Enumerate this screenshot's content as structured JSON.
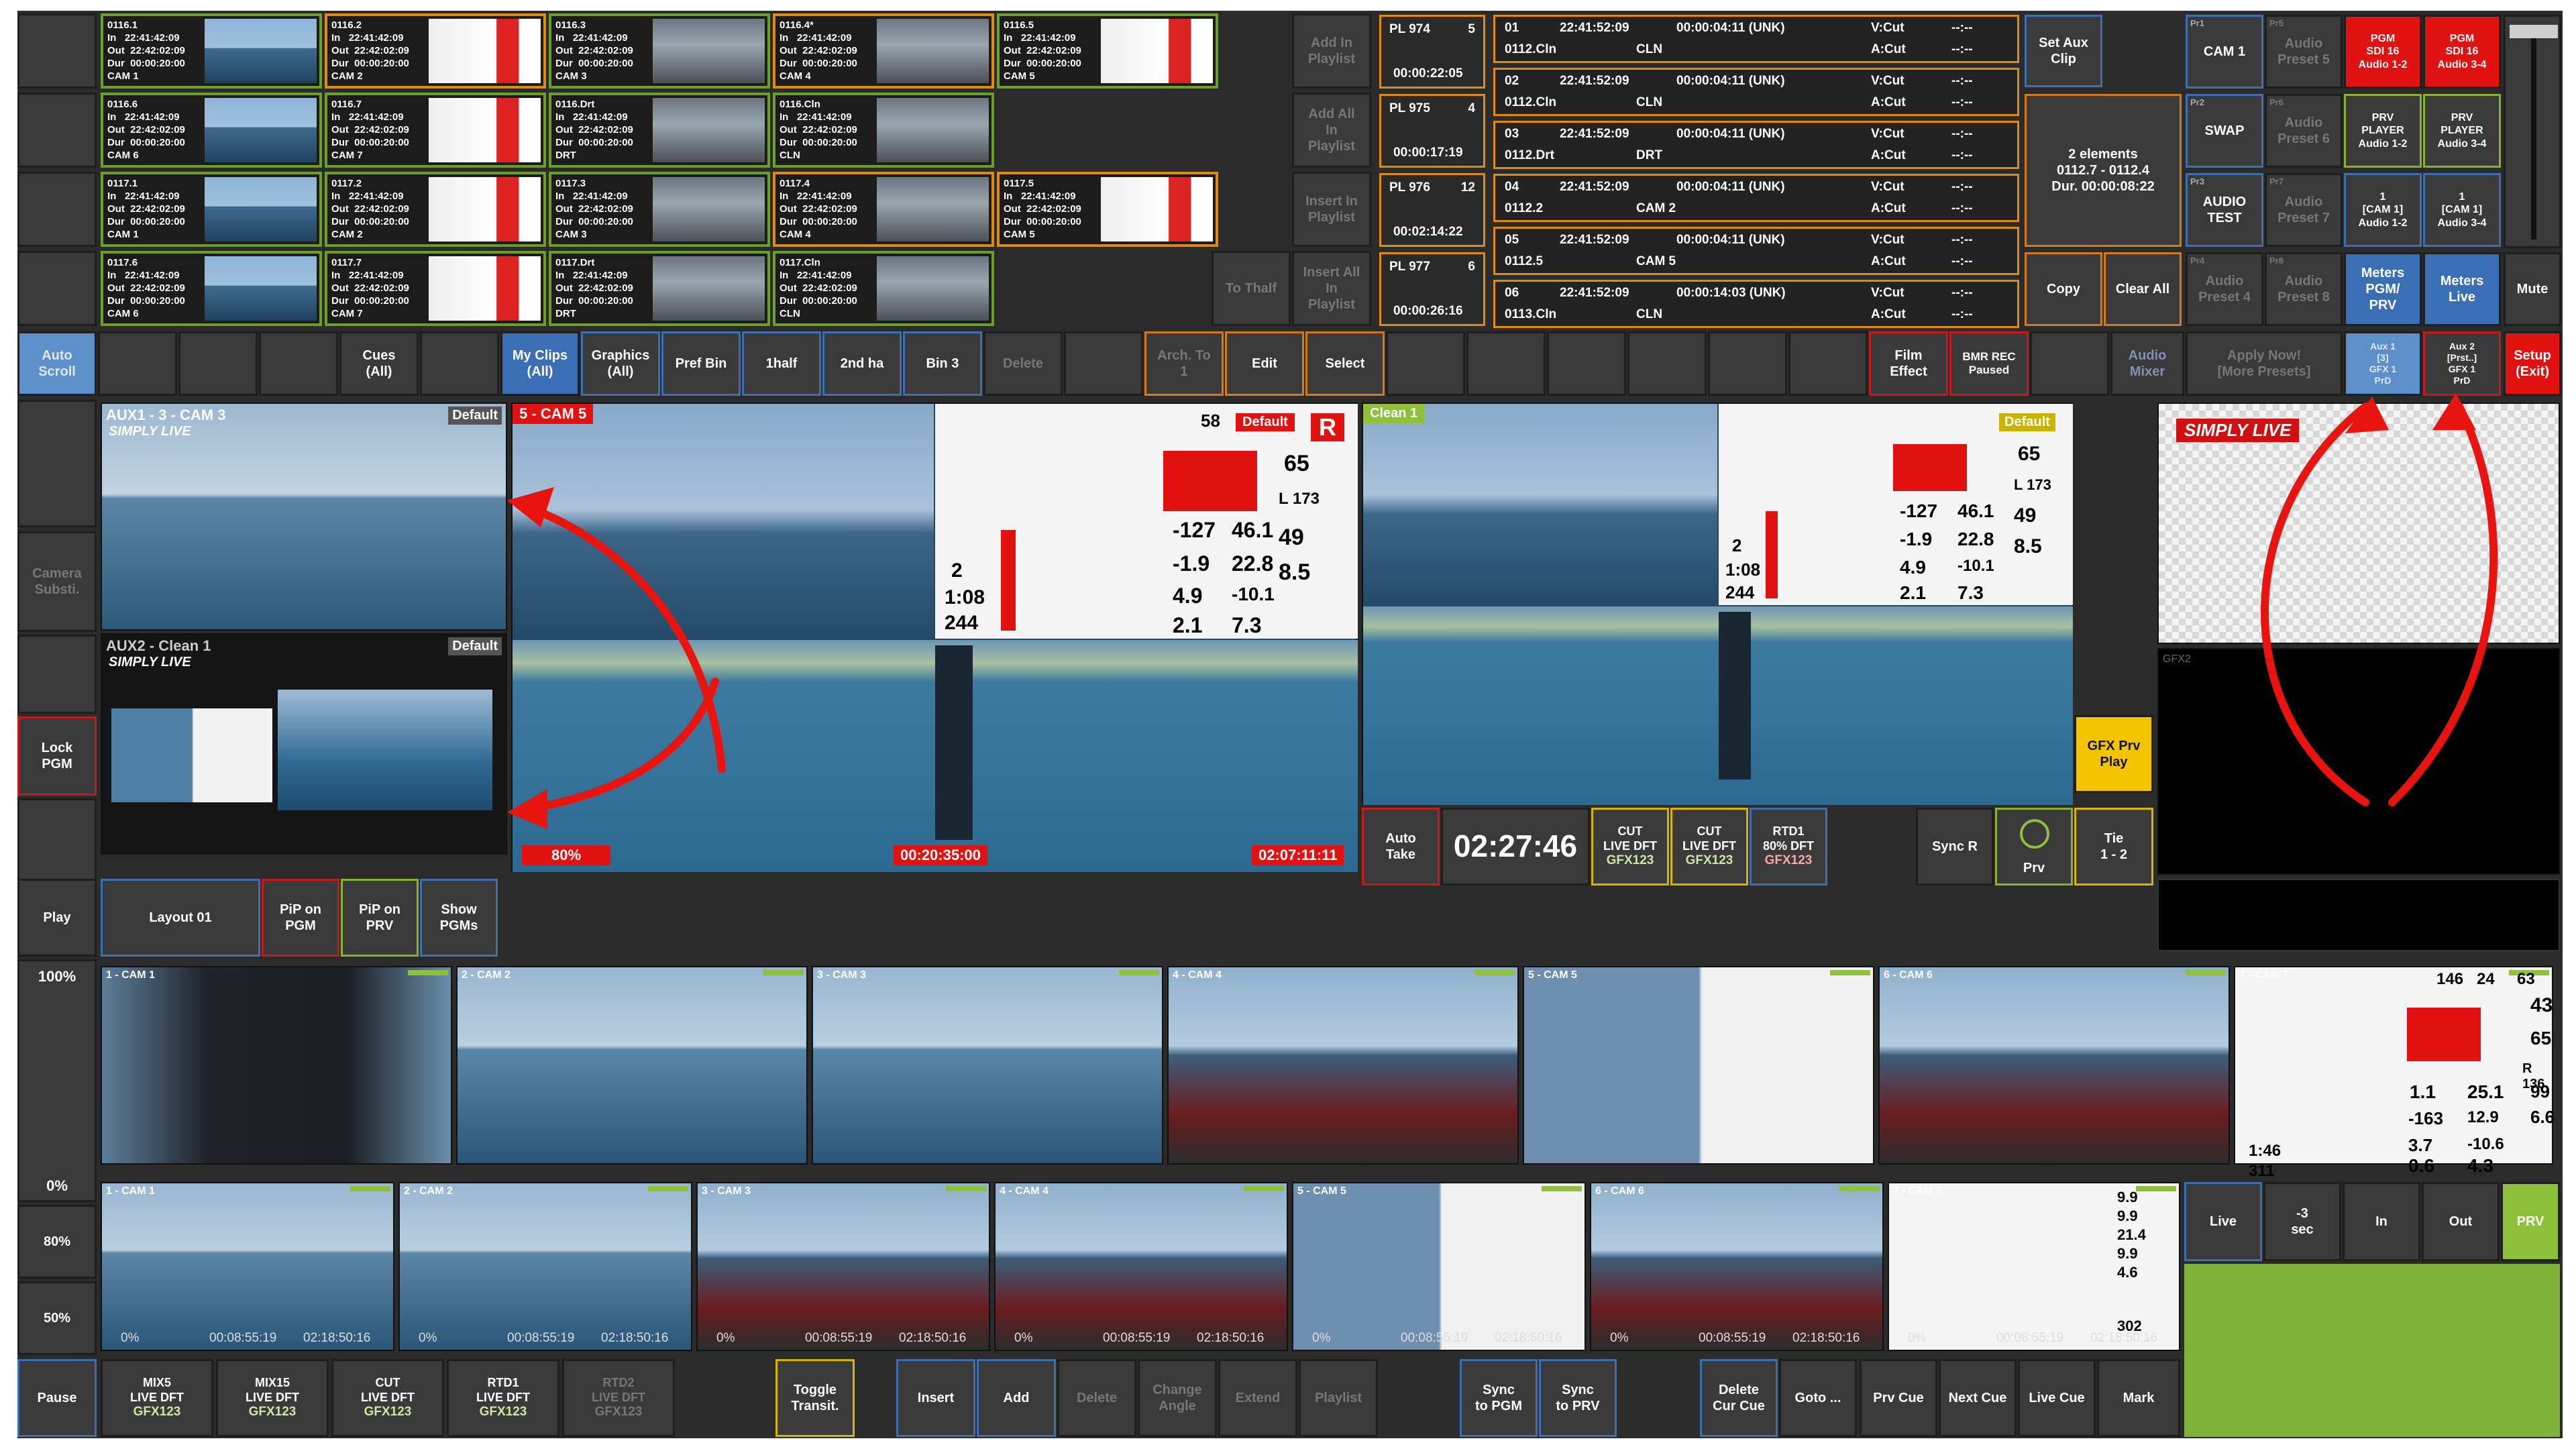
{
  "clips": [
    {
      "id": "0116.1",
      "in": "22:41:42:09",
      "out": "22:42:02:09",
      "dur": "00:00:20:00",
      "cam": "CAM 1",
      "style": "sea",
      "border": "green"
    },
    {
      "id": "0116.2",
      "in": "22:41:42:09",
      "out": "22:42:02:09",
      "dur": "00:00:20:00",
      "cam": "CAM 2",
      "style": "white",
      "border": "orange"
    },
    {
      "id": "0116.3",
      "in": "22:41:42:09",
      "out": "22:42:02:09",
      "dur": "00:00:20:00",
      "cam": "CAM 3",
      "style": "deck",
      "border": "green"
    },
    {
      "id": "0116.4*",
      "in": "22:41:42:09",
      "out": "22:42:02:09",
      "dur": "00:00:20:00",
      "cam": "CAM 4",
      "style": "deck",
      "border": "orange"
    },
    {
      "id": "0116.5",
      "in": "22:41:42:09",
      "out": "22:42:02:09",
      "dur": "00:00:20:00",
      "cam": "CAM 5",
      "style": "white",
      "border": "green"
    },
    {
      "id": "0116.6",
      "in": "22:41:42:09",
      "out": "22:42:02:09",
      "dur": "00:00:20:00",
      "cam": "CAM 6",
      "style": "sea",
      "border": "green"
    },
    {
      "id": "0116.7",
      "in": "22:41:42:09",
      "out": "22:42:02:09",
      "dur": "00:00:20:00",
      "cam": "CAM 7",
      "style": "white",
      "border": "green"
    },
    {
      "id": "0116.Drt",
      "in": "22:41:42:09",
      "out": "22:42:02:09",
      "dur": "00:00:20:00",
      "cam": "DRT",
      "style": "deck",
      "border": "green"
    },
    {
      "id": "0116.Cln",
      "in": "22:41:42:09",
      "out": "22:42:02:09",
      "dur": "00:00:20:00",
      "cam": "CLN",
      "style": "deck",
      "border": "green"
    },
    {
      "id": "0117.1",
      "in": "22:41:42:09",
      "out": "22:42:02:09",
      "dur": "00:00:20:00",
      "cam": "CAM 1",
      "style": "sea",
      "border": "green"
    },
    {
      "id": "0117.2",
      "in": "22:41:42:09",
      "out": "22:42:02:09",
      "dur": "00:00:20:00",
      "cam": "CAM 2",
      "style": "white",
      "border": "green"
    },
    {
      "id": "0117.3",
      "in": "22:41:42:09",
      "out": "22:42:02:09",
      "dur": "00:00:20:00",
      "cam": "CAM 3",
      "style": "deck",
      "border": "green"
    },
    {
      "id": "0117.4",
      "in": "22:41:42:09",
      "out": "22:42:02:09",
      "dur": "00:00:20:00",
      "cam": "CAM 4",
      "style": "deck",
      "border": "orange"
    },
    {
      "id": "0117.5",
      "in": "22:41:42:09",
      "out": "22:42:02:09",
      "dur": "00:00:20:00",
      "cam": "CAM 5",
      "style": "white",
      "border": "orange"
    },
    {
      "id": "0117.6",
      "in": "22:41:42:09",
      "out": "22:42:02:09",
      "dur": "00:00:20:00",
      "cam": "CAM 6",
      "style": "sea",
      "border": "green"
    },
    {
      "id": "0117.7",
      "in": "22:41:42:09",
      "out": "22:42:02:09",
      "dur": "00:00:20:00",
      "cam": "CAM 7",
      "style": "white",
      "border": "green"
    },
    {
      "id": "0117.Drt",
      "in": "22:41:42:09",
      "out": "22:42:02:09",
      "dur": "00:00:20:00",
      "cam": "DRT",
      "style": "deck",
      "border": "green"
    },
    {
      "id": "0117.Cln",
      "in": "22:41:42:09",
      "out": "22:42:02:09",
      "dur": "00:00:20:00",
      "cam": "CLN",
      "style": "deck",
      "border": "green"
    }
  ],
  "clip_actions": [
    "Add In\nPlaylist",
    "Add All\nIn\nPlaylist",
    "Insert In\nPlaylist",
    "Insert All\nIn\nPlaylist"
  ],
  "to_thalf": "To Thalf",
  "playlists": [
    {
      "name": "PL 974",
      "count": "5",
      "dur": "00:00:22:05"
    },
    {
      "name": "PL 975",
      "count": "4",
      "dur": "00:00:17:19"
    },
    {
      "name": "PL 976",
      "count": "12",
      "dur": "00:02:14:22"
    },
    {
      "name": "PL 977",
      "count": "6",
      "dur": "00:00:26:16"
    }
  ],
  "playlist_events": [
    {
      "num": "01",
      "time": "22:41:52:09",
      "dur": "00:00:04:11 (UNK)",
      "clip": "0112.Cln",
      "cam": "CLN",
      "vcut": "V:Cut",
      "acut": "A:Cut",
      "d1": "--:--",
      "d2": "--:--"
    },
    {
      "num": "02",
      "time": "22:41:52:09",
      "dur": "00:00:04:11 (UNK)",
      "clip": "0112.Cln",
      "cam": "CLN",
      "vcut": "V:Cut",
      "acut": "A:Cut",
      "d1": "--:--",
      "d2": "--:--"
    },
    {
      "num": "03",
      "time": "22:41:52:09",
      "dur": "00:00:04:11 (UNK)",
      "clip": "0112.Drt",
      "cam": "DRT",
      "vcut": "V:Cut",
      "acut": "A:Cut",
      "d1": "--:--",
      "d2": "--:--"
    },
    {
      "num": "04",
      "time": "22:41:52:09",
      "dur": "00:00:04:11 (UNK)",
      "clip": "0112.2",
      "cam": "CAM 2",
      "vcut": "V:Cut",
      "acut": "A:Cut",
      "d1": "--:--",
      "d2": "--:--"
    },
    {
      "num": "05",
      "time": "22:41:52:09",
      "dur": "00:00:04:11 (UNK)",
      "clip": "0112.5",
      "cam": "CAM 5",
      "vcut": "V:Cut",
      "acut": "A:Cut",
      "d1": "--:--",
      "d2": "--:--"
    },
    {
      "num": "06",
      "time": "22:41:52:09",
      "dur": "00:00:14:03 (UNK)",
      "clip": "0113.Cln",
      "cam": "CLN",
      "vcut": "V:Cut",
      "acut": "A:Cut",
      "d1": "--:--",
      "d2": "--:--"
    }
  ],
  "set_aux_clip": "Set Aux\nClip",
  "selection_info": "2 elements\n0112.7 - 0112.4\nDur. 00:00:08:22",
  "copy": "Copy",
  "clear_all": "Clear All",
  "audio_presets": {
    "pr1": "Pr1",
    "cam1": "CAM 1",
    "pr5": "Pr5",
    "ap5": "Audio\nPreset 5",
    "pgm1": "PGM\nSDI 16\nAudio 1-2",
    "pgm2": "PGM\nSDI 16\nAudio 3-4",
    "pr2": "Pr2",
    "swap": "SWAP",
    "pr6": "Pr6",
    "ap6": "Audio\nPreset 6",
    "prv1": "PRV\nPLAYER\nAudio 1-2",
    "prv2": "PRV\nPLAYER\nAudio 3-4",
    "pr3": "Pr3",
    "test": "AUDIO\nTEST",
    "pr7": "Pr7",
    "ap7": "Audio\nPreset 7",
    "c1a": "1\n[CAM 1]\nAudio 1-2",
    "c1b": "1\n[CAM 1]\nAudio 3-4",
    "pr4": "Pr4",
    "ap4": "Audio\nPreset 4",
    "pr8": "Pr8",
    "ap8": "Audio\nPreset 8",
    "meters_pgm": "Meters\nPGM/\nPRV",
    "meters_live": "Meters\nLive",
    "mute": "Mute"
  },
  "bar2": {
    "auto_scroll": "Auto\nScroll",
    "cues": "Cues\n(All)",
    "my_clips": "My Clips\n(All)",
    "graphics": "Graphics\n(All)",
    "pref_bin": "Pref Bin",
    "half1": "1half",
    "half2": "2nd ha",
    "bin3": "Bin 3",
    "delete": "Delete",
    "arch": "Arch. To\n1",
    "edit": "Edit",
    "select": "Select",
    "film": "Film\nEffect",
    "bmr": "BMR REC",
    "bmr_status": "Paused",
    "audio_mixer": "Audio\nMixer",
    "apply": "Apply Now!\n[More Presets]",
    "aux1": "Aux 1\n[3]\nGFX 1\nPrD",
    "aux2": "Aux 2\n[Prst..]\nGFX 1\nPrD",
    "setup": "Setup\n(Exit)"
  },
  "left_controls": {
    "camera_subst": "Camera\nSubsti.",
    "lock_pgm": "Lock\nPGM",
    "play": "Play",
    "layout": "Layout 01",
    "pip_pgm": "PiP on\nPGM",
    "pip_prv": "PiP on\nPRV",
    "show_pgms": "Show\nPGMs"
  },
  "aux_monitors": {
    "aux1_label": "AUX1 - 3 - CAM 3",
    "aux1_badge": "Default",
    "aux2_label": "AUX2 - Clean 1",
    "aux2_badge": "Default",
    "brand": "SIMPLY LIVE"
  },
  "pgm_monitor": {
    "label": "5 - CAM 5",
    "badge": "Default",
    "rec": "R",
    "speed": "80%",
    "tc_left": "00:20:35:00",
    "tc_right": "02:07:11:11",
    "hud": [
      "65",
      "L 173",
      "-127",
      "46.1",
      "-1.9",
      "22.8",
      "49",
      "8.5",
      "2",
      "1:08",
      "4.9",
      "-10.1",
      "244",
      "2.1",
      "7.3",
      "58"
    ]
  },
  "clean_monitor": {
    "label": "Clean 1",
    "badge": "Default",
    "hud": [
      "65",
      "L 173",
      "-127",
      "46.1",
      "-1.9",
      "22.8",
      "49",
      "8.5",
      "2",
      "1:08",
      "4.9",
      "-10.1",
      "244",
      "2.1",
      "7.3"
    ]
  },
  "gfx_prv_play": "GFX Prv\nPlay",
  "transport": {
    "auto_take": "Auto\nTake",
    "clock": "02:27:46",
    "cut1": "CUT\nLIVE DFT",
    "cut2": "CUT\nLIVE DFT",
    "rtd1": "RTD1\n80% DFT",
    "gfx": "GFX123",
    "sync_r": "Sync R",
    "prv": "Prv",
    "tie": "Tie\n1 - 2"
  },
  "gfx_monitors": {
    "gfx1": "SIMPLY LIVE",
    "gfx2": "GFX2"
  },
  "speed_controls": {
    "p100": "100%",
    "p0": "0%",
    "p80": "80%",
    "p50": "50%"
  },
  "live_cams": [
    "1 - CAM 1",
    "2 - CAM 2",
    "3 - CAM 3",
    "4 - CAM 4",
    "5 - CAM 5",
    "6 - CAM 6",
    "7 - CAM 7"
  ],
  "live_hud": [
    "146",
    "24",
    "63",
    "43",
    "65",
    "R 136",
    "1.1",
    "25.1",
    "99",
    "-163",
    "12.9",
    "6.6",
    "3.7",
    "-10.6",
    "1:46",
    "311",
    "0.6",
    "4.3"
  ],
  "replay_cams": [
    {
      "label": "1 - CAM 1",
      "pct": "0%",
      "t1": "00:08:55:19",
      "t2": "02:18:50:16"
    },
    {
      "label": "2 - CAM 2",
      "pct": "0%",
      "t1": "00:08:55:19",
      "t2": "02:18:50:16"
    },
    {
      "label": "3 - CAM 3",
      "pct": "0%",
      "t1": "00:08:55:19",
      "t2": "02:18:50:16"
    },
    {
      "label": "4 - CAM 4",
      "pct": "0%",
      "t1": "00:08:55:19",
      "t2": "02:18:50:16"
    },
    {
      "label": "5 - CAM 5",
      "pct": "0%",
      "t1": "00:08:55:19",
      "t2": "02:18:50:16"
    },
    {
      "label": "6 - CAM 6",
      "pct": "0%",
      "t1": "00:08:55:19",
      "t2": "02:18:50:16"
    },
    {
      "label": "7 - CAM 7",
      "pct": "0%",
      "t1": "00:08:55:19",
      "t2": "02:18:50:16"
    }
  ],
  "replay_hud": [
    "9.9",
    "9.9",
    "21.4",
    "9.9",
    "4.6",
    "302"
  ],
  "cue_buttons": {
    "live": "Live",
    "sec": "-3\nsec",
    "in": "In",
    "out": "Out",
    "prv": "PRV"
  },
  "bottom": {
    "pause": "Pause",
    "mix5": "MIX5\nLIVE DFT",
    "mix15": "MIX15\nLIVE DFT",
    "cut": "CUT\nLIVE DFT",
    "rtd1": "RTD1\nLIVE DFT",
    "rtd2": "RTD2\nLIVE DFT",
    "gfx": "GFX123",
    "toggle": "Toggle\nTransit.",
    "insert": "Insert",
    "add": "Add",
    "delete": "Delete",
    "change_angle": "Change\nAngle",
    "extend": "Extend",
    "playlist": "Playlist",
    "sync_pgm": "Sync\nto PGM",
    "sync_prv": "Sync\nto PRV",
    "delete_cue": "Delete\nCur Cue",
    "goto": "Goto ...",
    "prv_cue": "Prv Cue",
    "next_cue": "Next Cue",
    "live_cue": "Live Cue",
    "mark": "Mark"
  },
  "colors": {
    "accent_green": "#8fc03b",
    "tally_red": "#e01212",
    "border_orange": "#e08a16",
    "button_blue": "#3a6fb5",
    "yellow": "#f4c400"
  }
}
